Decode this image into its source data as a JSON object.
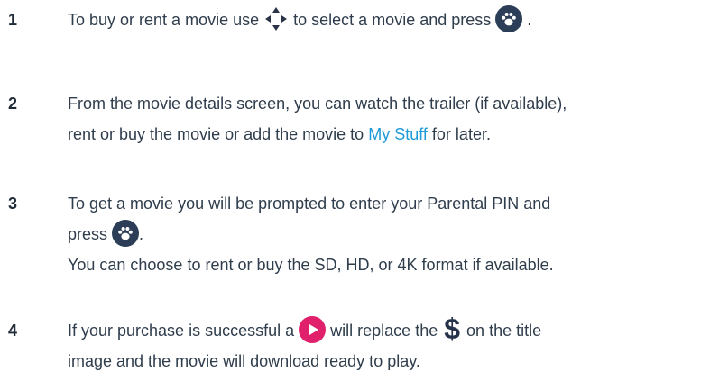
{
  "steps": [
    {
      "number": "1",
      "pre": "To buy or rent a movie use",
      "mid": "to select a movie and press",
      "post": "."
    },
    {
      "number": "2",
      "line1": "From the movie details screen, you can watch the trailer (if available),",
      "line2_pre": "rent or buy the movie or add the movie to",
      "link": "My Stuff",
      "line2_post": "for later."
    },
    {
      "number": "3",
      "line1": "To get a movie you will be prompted to enter your Parental PIN and",
      "line2_pre": "press",
      "line2_post": ".",
      "line3": "You can choose to rent or buy the SD, HD, or 4K format if available."
    },
    {
      "number": "4",
      "line1_pre": "If your purchase is successful a",
      "line1_mid": "will replace the",
      "line1_post": "on the title",
      "line2": "image and the movie will download ready to play."
    }
  ],
  "icons": {
    "paw": "paw-button-icon",
    "dpad": "dpad-arrows-icon",
    "play": "play-icon",
    "dollar": "dollar-icon",
    "dollar_glyph": "$"
  },
  "colors": {
    "text": "#2f3d4c",
    "link": "#1e9bd7",
    "paw_bg": "#2b3d57",
    "play_bg": "#e0206b"
  }
}
